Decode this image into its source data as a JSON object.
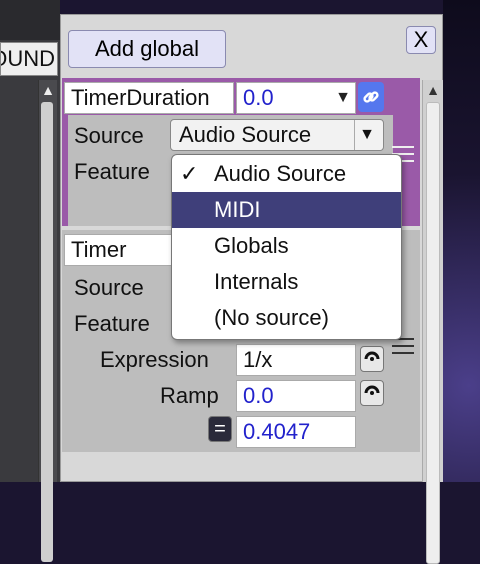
{
  "left": {
    "tab_label": "OUND"
  },
  "toolbar": {
    "add_global_label": "Add global",
    "close_label": "X"
  },
  "panel1": {
    "name": "TimerDuration",
    "value": "0.0",
    "source_label": "Source",
    "feature_label": "Feature",
    "source_selected": "Audio Source"
  },
  "dropdown": {
    "options": [
      "Audio Source",
      "MIDI",
      "Globals",
      "Internals",
      "(No source)"
    ],
    "checked_index": 0,
    "highlighted_index": 1
  },
  "panel2": {
    "name": "Timer",
    "source_label": "Source",
    "feature_label": "Feature",
    "expression_label": "Expression",
    "expression_value": "1/x",
    "ramp_label": "Ramp",
    "ramp_value": "0.0",
    "result_value": "0.4047"
  },
  "glyphs": {
    "check": "✓",
    "dropdown_arrow": "▼",
    "scroll_up": "▲",
    "link": "🔗",
    "equals": "=",
    "menu": "☰",
    "knob": "◚"
  },
  "colors": {
    "accent_purple": "#9a5aa8",
    "highlight": "#3f3f7a",
    "number_blue": "#2222cc",
    "link_blue": "#5577ee"
  }
}
